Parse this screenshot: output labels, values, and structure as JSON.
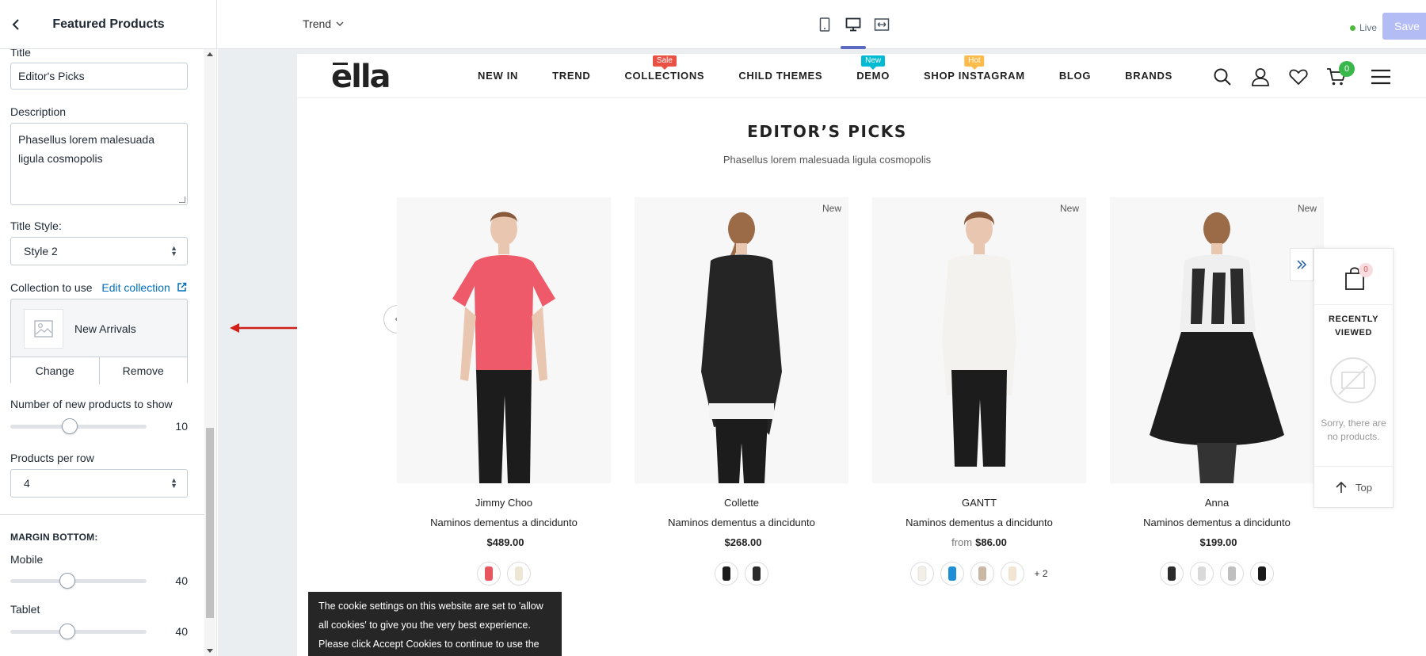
{
  "editor": {
    "panel_title": "Featured Products",
    "page_selector": "Trend",
    "view_modes": [
      "mobile",
      "desktop",
      "full-width"
    ],
    "live_label": "Live",
    "save_label": "Save"
  },
  "sidebar": {
    "title_label": "Title",
    "title_value": "Editor's Picks",
    "description_label": "Description",
    "description_value": "Phasellus lorem malesuada ligula cosmopolis",
    "title_style_label": "Title Style:",
    "title_style_value": "Style 2",
    "collection_label": "Collection to use",
    "edit_collection_link": "Edit collection",
    "collection_name": "New Arrivals",
    "change_label": "Change",
    "remove_label": "Remove",
    "num_products_label": "Number of new products to show",
    "num_products_value": "10",
    "per_row_label": "Products per row",
    "per_row_value": "4",
    "margin_heading": "MARGIN BOTTOM:",
    "mobile_label": "Mobile",
    "mobile_value": "40",
    "tablet_label": "Tablet",
    "tablet_value": "40"
  },
  "store": {
    "logo": "ella",
    "nav": [
      {
        "label": "NEW IN"
      },
      {
        "label": "TREND"
      },
      {
        "label": "COLLECTIONS",
        "badge": "Sale",
        "badge_color": "#e95144"
      },
      {
        "label": "CHILD THEMES"
      },
      {
        "label": "DEMO",
        "badge": "New",
        "badge_color": "#01bad4"
      },
      {
        "label": "SHOP INSTAGRAM",
        "badge": "Hot",
        "badge_color": "#ffbb49"
      },
      {
        "label": "BLOG"
      },
      {
        "label": "BRANDS"
      }
    ],
    "cart_count": "0",
    "section_title": "EDITOR’S PICKS",
    "section_desc": "Phasellus lorem malesuada ligula cosmopolis",
    "products": [
      {
        "vendor": "Jimmy Choo",
        "name": "Naminos dementus a dincidunto",
        "price_prefix": "",
        "price": "$489.00",
        "badge": "",
        "swatch_colors": [
          "#e8555f",
          "#efe7d6"
        ],
        "more": ""
      },
      {
        "vendor": "Collette",
        "name": "Naminos dementus a dincidunto",
        "price_prefix": "",
        "price": "$268.00",
        "badge": "New",
        "swatch_colors": [
          "#1b1b1b",
          "#2a2a2a"
        ],
        "more": ""
      },
      {
        "vendor": "GANTT",
        "name": "Naminos dementus a dincidunto",
        "price_prefix": "from",
        "price": "$86.00",
        "badge": "New",
        "swatch_colors": [
          "#f3efe6",
          "#1e8fd6",
          "#c9b9a4",
          "#f1e4d2"
        ],
        "more": "+ 2"
      },
      {
        "vendor": "Anna",
        "name": "Naminos dementus a dincidunto",
        "price_prefix": "",
        "price": "$199.00",
        "badge": "New",
        "swatch_colors": [
          "#2b2b2b",
          "#d9d9d9",
          "#bfbfbf",
          "#1a1a1a"
        ],
        "more": ""
      }
    ],
    "recently_viewed": {
      "count": "0",
      "title": "RECENTLY VIEWED",
      "empty_text": "Sorry, there are no products.",
      "top_label": "Top"
    },
    "cookie_text": "The cookie settings on this website are set to 'allow all cookies' to give you the very best experience. Please click Accept Cookies to continue to use the site."
  }
}
